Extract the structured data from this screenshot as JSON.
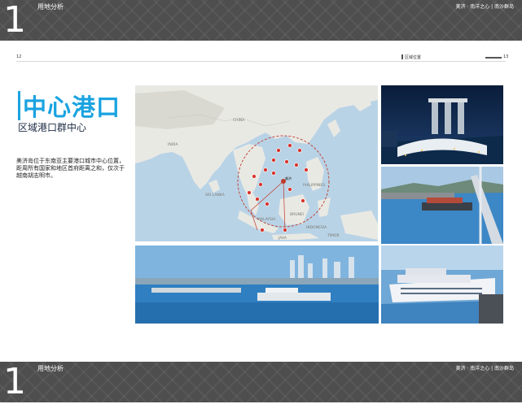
{
  "header": {
    "number": "1",
    "section": "用地分析",
    "right_text": "美济 · 南洋之心 | 南沙群岛"
  },
  "page": {
    "left_number": "12",
    "breadcrumb": "区域位置",
    "right_number": "13"
  },
  "content": {
    "title": "中心港口",
    "subtitle": "区域港口群中心",
    "description": "美济岛位于东南亚主要港口城市中心位置，距周所有国家和地区首府距离之和，仅次于越南胡志明市。"
  },
  "map": {
    "labels": [
      "CHINA",
      "INDIA",
      "SRI LANKA",
      "PHILIPPINES",
      "BRUNEI",
      "MALAYSIA",
      "INDONESIA",
      "JAVA",
      "TIMOR",
      "美济"
    ],
    "port_color": "#d9342b",
    "circle_color": "#c0392b"
  },
  "footer": {
    "number": "1",
    "section": "用地分析",
    "right_text": "美济 · 南洋之心 | 南沙群岛"
  },
  "colors": {
    "accent": "#1aa3e0",
    "band": "#4e4e4e"
  }
}
